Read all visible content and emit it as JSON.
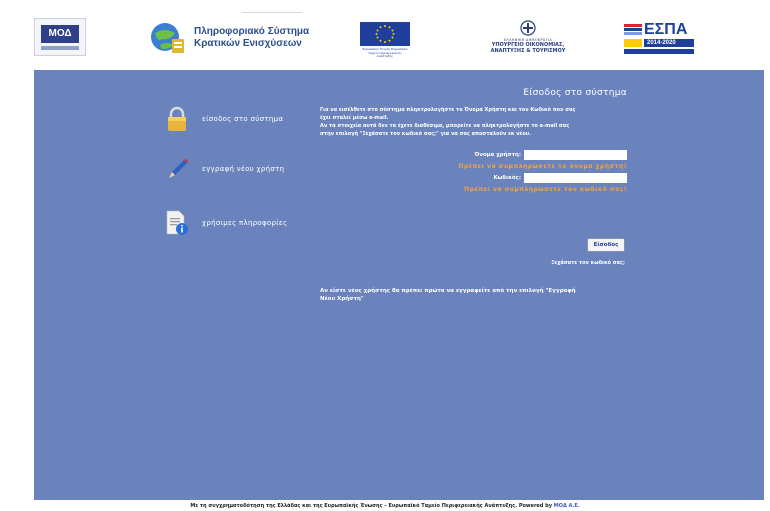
{
  "header": {
    "moa_logo_text": "ΜΟΔ",
    "system_name_line1": "Πληροφοριακό Σύστημα",
    "system_name_line2": "Κρατικών Ενισχύσεων",
    "eu_caption": "Ευρωπαϊκή Ένωση Ευρωπαϊκό Ταμείο Περιφερειακής Ανάπτυξης",
    "ministry_line1": "ΕΛΛΗΝΙΚΗ ΔΗΜΟΚΡΑΤΙΑ",
    "ministry_line2": "ΥΠΟΥΡΓΕΙΟ ΟΙΚΟΝΟΜΙΑΣ,",
    "ministry_line3": "ΑΝΑΠΤΥΞΗΣ & ΤΟΥΡΙΣΜΟΥ",
    "espa_word": "ΕΣΠΑ",
    "espa_years": "2014-2020"
  },
  "menu": {
    "login": "είσοδος στο σύστημα",
    "register": "εγγραφή νέου χρήστη",
    "info": "χρήσιμες πληροφορίες"
  },
  "login": {
    "heading": "Είσοδος στο σύστημα",
    "intro_line1": "Για να εισέλθετε στο σύστημα πληκτρολογήστε το Όνομα Χρήστη και τον Κωδικό που σας",
    "intro_line2": "έχει σταλεί μέσω e-mail.",
    "intro_line3": "Αν τα στοιχεία αυτά δεν τα έχετε διαθέσιμα, μπορείτε να πληκτρολογήστε το e-mail σας",
    "intro_line4": "στην επιλογή \"Ξεχάσατε τον κωδικό σας;\" για να σας αποσταλούν εκ νέου.",
    "username_label": "Όνομα χρήστη:",
    "username_value": "",
    "username_error": "Πρέπει να συμπληρώσετε το όνομα χρήστη!",
    "password_label": "Κωδικός:",
    "password_value": "",
    "password_error": "Πρέπει να συμπληρώσετε τον κωδικό σας!",
    "submit_label": "Είσοδος",
    "forgot_label": "Ξεχάσατε τον κωδικό σας;",
    "newuser_line1": "Αν είστε νέος χρήστης θα πρέπει πρώτα να εγγραφείτε από την επιλογή \"Εγγραφή",
    "newuser_line2": "Νέου Χρήστη\""
  },
  "footer": {
    "text": "Με τη συγχρηματοδότηση της Ελλάδας και της Ευρωπαϊκής Ένωσης – Ευρωπαϊκό Ταμείο Περιφερειακής Ανάπτυξης.  Powered by",
    "powered_link": "ΜΟΔ Α.Ε."
  },
  "colors": {
    "panel_bg": "#6b83bd",
    "error_text": "#f4a13a",
    "brand_blue": "#1f3f9a"
  }
}
